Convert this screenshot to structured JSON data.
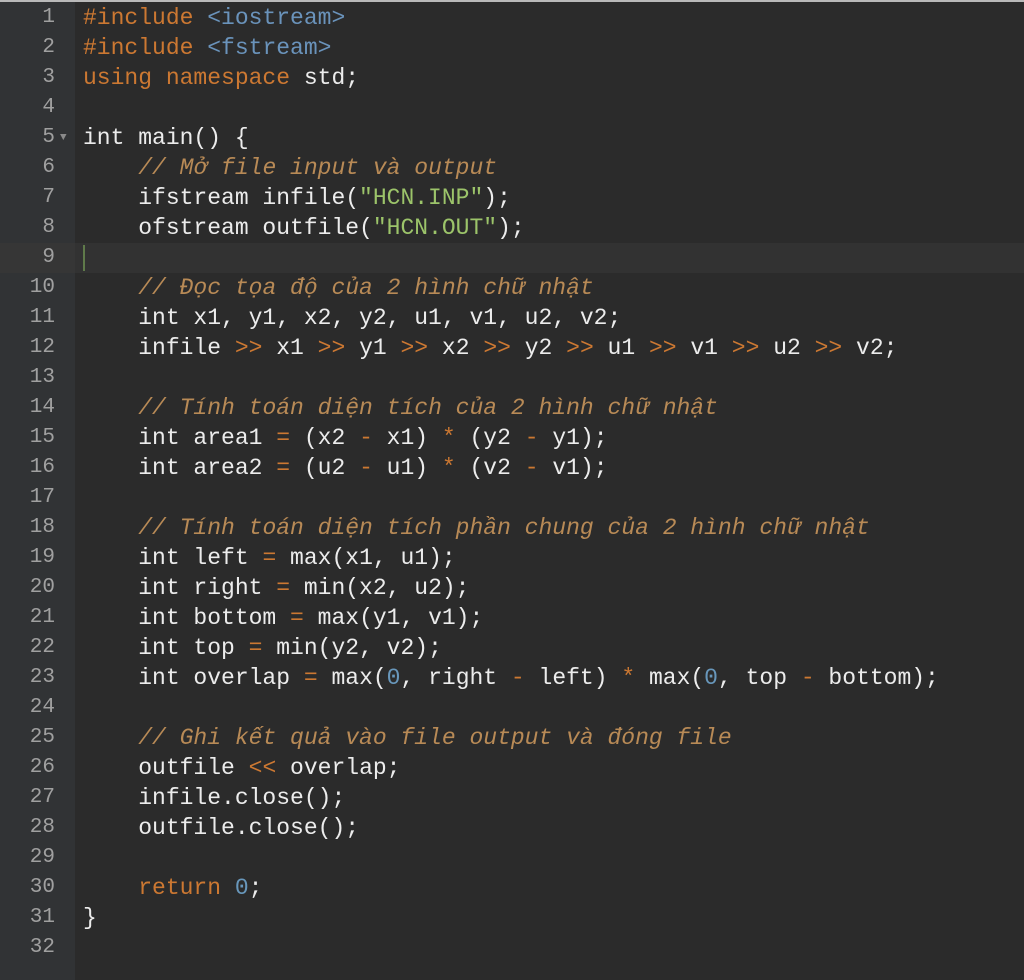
{
  "editor": {
    "active_line": 9,
    "fold_marker_line": 5,
    "colors": {
      "background": "#2b2b2b",
      "gutter": "#313335",
      "keyword": "#cc7832",
      "string": "#9cc46a",
      "comment": "#b88a56",
      "number": "#6897bb"
    },
    "lines": [
      [
        [
          "pp",
          "#include "
        ],
        [
          "hdr",
          "<iostream>"
        ]
      ],
      [
        [
          "pp",
          "#include "
        ],
        [
          "hdr",
          "<fstream>"
        ]
      ],
      [
        [
          "kw",
          "using namespace "
        ],
        [
          "pl",
          "std;"
        ]
      ],
      [],
      [
        [
          "pl",
          "int main() {"
        ]
      ],
      [
        [
          "pl",
          "    "
        ],
        [
          "cm",
          "// Mở file input và output"
        ]
      ],
      [
        [
          "pl",
          "    ifstream infile("
        ],
        [
          "str",
          "\"HCN.INP\""
        ],
        [
          "pl",
          ");"
        ]
      ],
      [
        [
          "pl",
          "    ofstream outfile("
        ],
        [
          "str",
          "\"HCN.OUT\""
        ],
        [
          "pl",
          ");"
        ]
      ],
      [],
      [
        [
          "pl",
          "    "
        ],
        [
          "cm",
          "// Đọc tọa độ của 2 hình chữ nhật"
        ]
      ],
      [
        [
          "pl",
          "    int x1, y1, x2, y2, u1, v1, u2, v2;"
        ]
      ],
      [
        [
          "pl",
          "    infile "
        ],
        [
          "op",
          ">>"
        ],
        [
          "pl",
          " x1 "
        ],
        [
          "op",
          ">>"
        ],
        [
          "pl",
          " y1 "
        ],
        [
          "op",
          ">>"
        ],
        [
          "pl",
          " x2 "
        ],
        [
          "op",
          ">>"
        ],
        [
          "pl",
          " y2 "
        ],
        [
          "op",
          ">>"
        ],
        [
          "pl",
          " u1 "
        ],
        [
          "op",
          ">>"
        ],
        [
          "pl",
          " v1 "
        ],
        [
          "op",
          ">>"
        ],
        [
          "pl",
          " u2 "
        ],
        [
          "op",
          ">>"
        ],
        [
          "pl",
          " v2;"
        ]
      ],
      [],
      [
        [
          "pl",
          "    "
        ],
        [
          "cm",
          "// Tính toán diện tích của 2 hình chữ nhật"
        ]
      ],
      [
        [
          "pl",
          "    int area1 "
        ],
        [
          "op",
          "="
        ],
        [
          "pl",
          " (x2 "
        ],
        [
          "op",
          "-"
        ],
        [
          "pl",
          " x1) "
        ],
        [
          "op",
          "*"
        ],
        [
          "pl",
          " (y2 "
        ],
        [
          "op",
          "-"
        ],
        [
          "pl",
          " y1);"
        ]
      ],
      [
        [
          "pl",
          "    int area2 "
        ],
        [
          "op",
          "="
        ],
        [
          "pl",
          " (u2 "
        ],
        [
          "op",
          "-"
        ],
        [
          "pl",
          " u1) "
        ],
        [
          "op",
          "*"
        ],
        [
          "pl",
          " (v2 "
        ],
        [
          "op",
          "-"
        ],
        [
          "pl",
          " v1);"
        ]
      ],
      [],
      [
        [
          "pl",
          "    "
        ],
        [
          "cm",
          "// Tính toán diện tích phần chung của 2 hình chữ nhật"
        ]
      ],
      [
        [
          "pl",
          "    int left "
        ],
        [
          "op",
          "="
        ],
        [
          "pl",
          " max(x1, u1);"
        ]
      ],
      [
        [
          "pl",
          "    int right "
        ],
        [
          "op",
          "="
        ],
        [
          "pl",
          " min(x2, u2);"
        ]
      ],
      [
        [
          "pl",
          "    int bottom "
        ],
        [
          "op",
          "="
        ],
        [
          "pl",
          " max(y1, v1);"
        ]
      ],
      [
        [
          "pl",
          "    int top "
        ],
        [
          "op",
          "="
        ],
        [
          "pl",
          " min(y2, v2);"
        ]
      ],
      [
        [
          "pl",
          "    int overlap "
        ],
        [
          "op",
          "="
        ],
        [
          "pl",
          " max("
        ],
        [
          "num",
          "0"
        ],
        [
          "pl",
          ", right "
        ],
        [
          "op",
          "-"
        ],
        [
          "pl",
          " left) "
        ],
        [
          "op",
          "*"
        ],
        [
          "pl",
          " max("
        ],
        [
          "num",
          "0"
        ],
        [
          "pl",
          ", top "
        ],
        [
          "op",
          "-"
        ],
        [
          "pl",
          " bottom);"
        ]
      ],
      [],
      [
        [
          "pl",
          "    "
        ],
        [
          "cm",
          "// Ghi kết quả vào file output và đóng file"
        ]
      ],
      [
        [
          "pl",
          "    outfile "
        ],
        [
          "op",
          "<<"
        ],
        [
          "pl",
          " overlap;"
        ]
      ],
      [
        [
          "pl",
          "    infile.close();"
        ]
      ],
      [
        [
          "pl",
          "    outfile.close();"
        ]
      ],
      [],
      [
        [
          "pl",
          "    "
        ],
        [
          "kw",
          "return "
        ],
        [
          "num",
          "0"
        ],
        [
          "pl",
          ";"
        ]
      ],
      [
        [
          "pl",
          "}"
        ]
      ],
      []
    ]
  }
}
